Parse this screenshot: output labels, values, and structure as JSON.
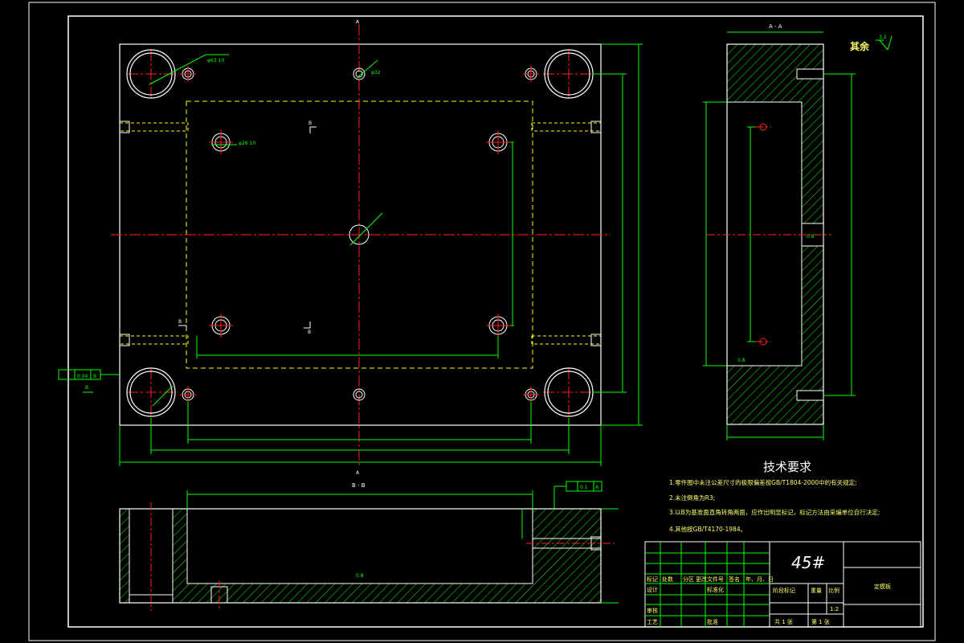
{
  "drawing": {
    "section_aa_label": "A - A",
    "section_bb_label": "B - B",
    "section_mark_a": "A",
    "section_mark_b": "B",
    "other_surfaces_label": "其余",
    "other_surfaces_roughness": "3.2",
    "hole_callout_top_left": "φ63 10",
    "hole_callout_center": "φ26 10",
    "hole_callout_top_mid": "φ32",
    "flatness_value": "0.04",
    "flatness_datum": "B",
    "parallel_value": "0.1",
    "parallel_datum": "A",
    "datum_b": "B",
    "roughness_small": "0.8"
  },
  "tech_requirements": {
    "title": "技术要求",
    "items": [
      "1.零件图中未注公差尺寸的极限偏差按GB/T1804-2000中的有关规定;",
      "2.未注倒角为R3;",
      "3.以B为基准面直角转角两面，应作出明显标记，标记方法由采编单位自行决定;",
      "4.其他按GB/T4170-1984。"
    ]
  },
  "title_block": {
    "material": "45#",
    "part_name": "定模板",
    "row_labels": [
      "标记",
      "处数",
      "分区",
      "更改文件号",
      "签名",
      "年、月、日"
    ],
    "design": "设计",
    "standardize": "标准化",
    "review": "审核",
    "process": "工艺",
    "approve": "批准",
    "stage_mark": "阶段标记",
    "weight": "重量",
    "scale_label": "比例",
    "scale": "1:2",
    "sheets_total": "共 1 张",
    "sheet_no": "第 1 张"
  },
  "colors": {
    "outline": "#ffffff",
    "hidden": "#ffff00",
    "center": "#ff2020",
    "dimension": "#00ff00",
    "hatch": "#00ff00",
    "border": "#ffffff"
  }
}
